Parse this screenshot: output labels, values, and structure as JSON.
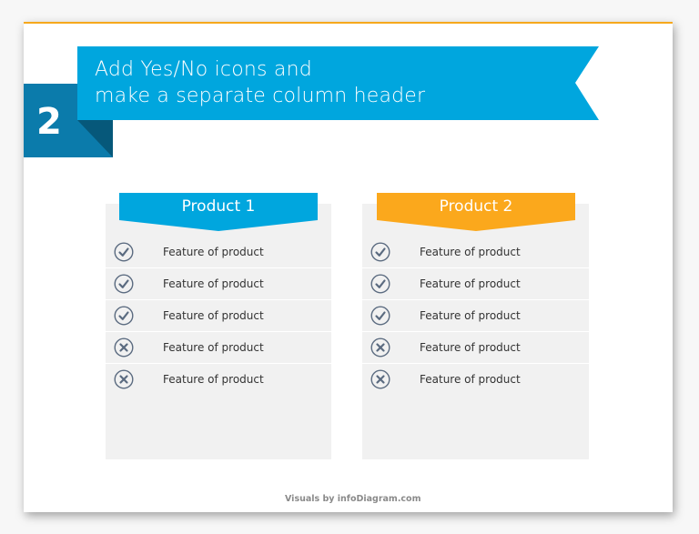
{
  "step_number": "2",
  "title": {
    "line1": "Add Yes/No icons and",
    "line2": "make a separate column header"
  },
  "colors": {
    "banner_blue": "#00a6de",
    "number_blue": "#0b7bab",
    "fold_dark": "#06587a",
    "product2_orange": "#fba81c",
    "top_accent": "#f6a81c",
    "card_gray": "#f1f1f1",
    "icon_gray": "#5b6b80"
  },
  "products": [
    {
      "name": "Product 1",
      "features": [
        {
          "label": "Feature of product",
          "status": "yes",
          "icon": "check-circle-icon"
        },
        {
          "label": "Feature of product",
          "status": "yes",
          "icon": "check-circle-icon"
        },
        {
          "label": "Feature of product",
          "status": "yes",
          "icon": "check-circle-icon"
        },
        {
          "label": "Feature of product",
          "status": "no",
          "icon": "x-circle-icon"
        },
        {
          "label": "Feature of product",
          "status": "no",
          "icon": "x-circle-icon"
        }
      ]
    },
    {
      "name": "Product 2",
      "features": [
        {
          "label": "Feature of product",
          "status": "yes",
          "icon": "check-circle-icon"
        },
        {
          "label": "Feature of product",
          "status": "yes",
          "icon": "check-circle-icon"
        },
        {
          "label": "Feature of product",
          "status": "yes",
          "icon": "check-circle-icon"
        },
        {
          "label": "Feature of product",
          "status": "no",
          "icon": "x-circle-icon"
        },
        {
          "label": "Feature of product",
          "status": "no",
          "icon": "x-circle-icon"
        }
      ]
    }
  ],
  "footer": "Visuals by infoDiagram.com"
}
